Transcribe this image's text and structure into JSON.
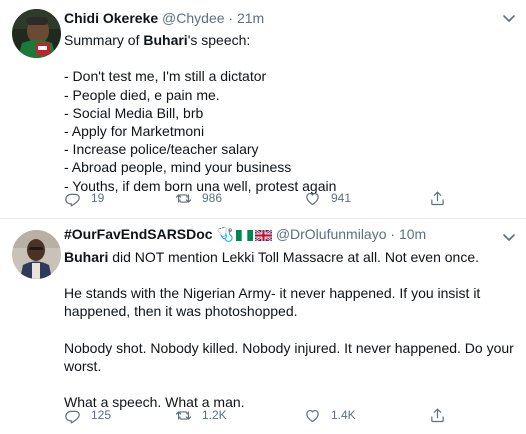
{
  "tweets": [
    {
      "name": "Chidi Okereke",
      "handle": "@Chydee",
      "separator": "·",
      "time": "21m",
      "intro_prefix": "Summary of ",
      "intro_bold": "Buhari",
      "intro_suffix": "'s speech:",
      "lines": [
        "- Don't test me, I'm still a dictator",
        "- People died, e pain me.",
        "- Social Media Bill, brb",
        "- Apply for Marketmoni",
        "- Increase police/teacher salary",
        "- Abroad people, mind your business",
        "- Youths, if dem born una well, protest again"
      ],
      "replies": "19",
      "retweets": "986",
      "likes": "941"
    },
    {
      "name": "#OurFavEndSARSDoc",
      "name_emoji": "🩺",
      "handle": "@DrOlufunmilayo",
      "separator": "·",
      "time": "10m",
      "p1_bold": "Buhari",
      "p1_rest": " did NOT mention Lekki Toll Massacre at all. Not even once.",
      "p2": "He stands with the Nigerian Army- it never happened. If you insist it happened, then it was photoshopped.",
      "p3": "Nobody shot. Nobody killed. Nobody injured. It never happened. Do your worst.",
      "p4": "What a speech. What a man.",
      "replies": "125",
      "retweets": "1.2K",
      "likes": "1.4K"
    }
  ],
  "icons": {
    "more": "more-chevron-icon",
    "reply": "reply-icon",
    "retweet": "retweet-icon",
    "like": "heart-icon",
    "share": "share-icon"
  },
  "colors": {
    "text": "#0f1419",
    "muted": "#5b7083",
    "divider": "#e6ecf0",
    "nigeria_green": "#008751"
  }
}
